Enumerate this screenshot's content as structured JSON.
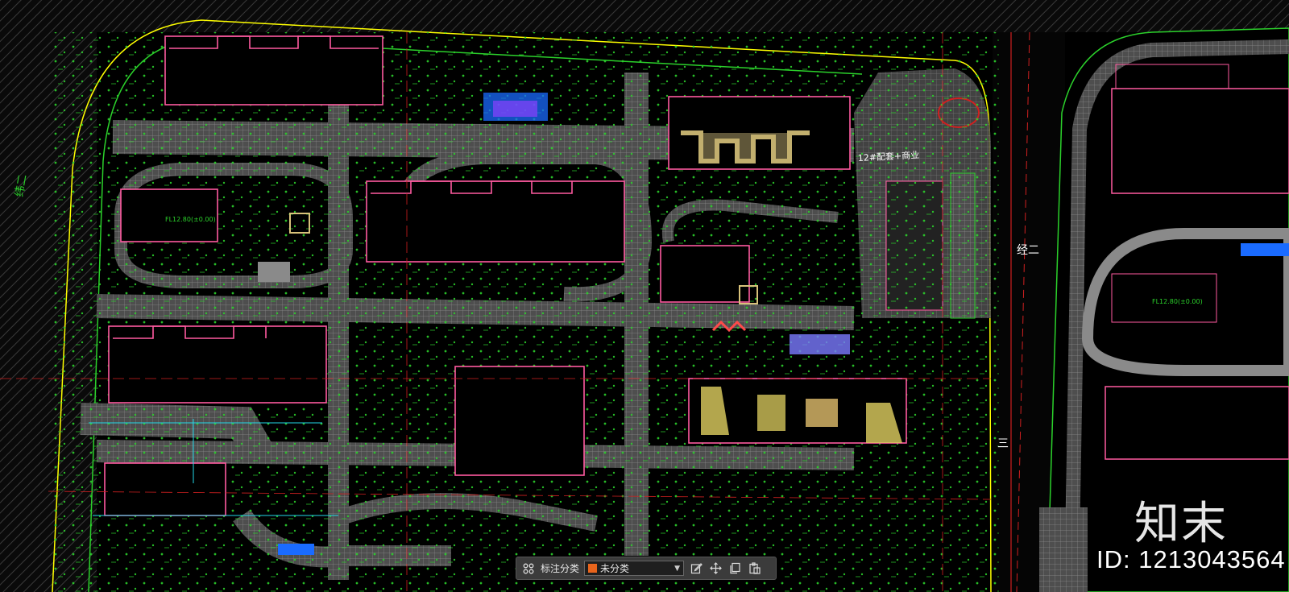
{
  "colors": {
    "background": "#000000",
    "street_hatch": "#4a4a4a",
    "road_paving": "#7a7a7a",
    "building_outline": "#ff5aa0",
    "annotation": "#22e022",
    "boundary": "#ffff00",
    "plaza_blue": "#1a6bff",
    "highlight_tan": "#d8c27a"
  },
  "map_labels": {
    "road_left": "纬二",
    "road_right": "经二",
    "road_mid": "三",
    "site_label": "12#配套+商业",
    "level_1": "FL12.80(±0.00)",
    "level_2": "FL12.80(±0.00)"
  },
  "toolbar": {
    "grid_icon": "grid-icon",
    "category_label": "标注分类",
    "selected_category": "未分类",
    "selected_color": "#e8641c",
    "edit_icon": "edit-icon",
    "move_icon": "move-icon",
    "copy_icon": "copy-icon",
    "paste_icon": "paste-icon"
  },
  "watermark": {
    "logo": "知末",
    "id_text": "ID: 1213043564"
  }
}
